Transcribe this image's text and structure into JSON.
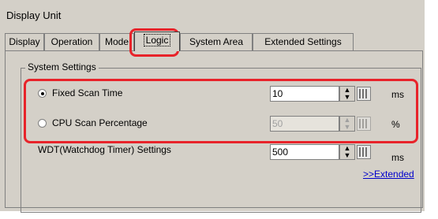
{
  "window": {
    "title": "Display Unit"
  },
  "tabs": [
    {
      "label": "Display"
    },
    {
      "label": "Operation"
    },
    {
      "label": "Mode"
    },
    {
      "label": "Logic"
    },
    {
      "label": "System Area"
    },
    {
      "label": "Extended Settings"
    }
  ],
  "system_settings": {
    "title": "System Settings",
    "fixed_scan": {
      "label": "Fixed Scan Time",
      "value": "10",
      "unit": "ms",
      "selected": true
    },
    "cpu_scan": {
      "label": "CPU Scan Percentage",
      "value": "50",
      "unit": "%",
      "selected": false
    },
    "wdt": {
      "label": "WDT(Watchdog Timer) Settings",
      "value": "500",
      "unit": "ms"
    },
    "extended_link": ">>Extended"
  },
  "colors": {
    "highlight": "#e8232a",
    "panel": "#d4d0c8",
    "link": "#0000cc"
  }
}
